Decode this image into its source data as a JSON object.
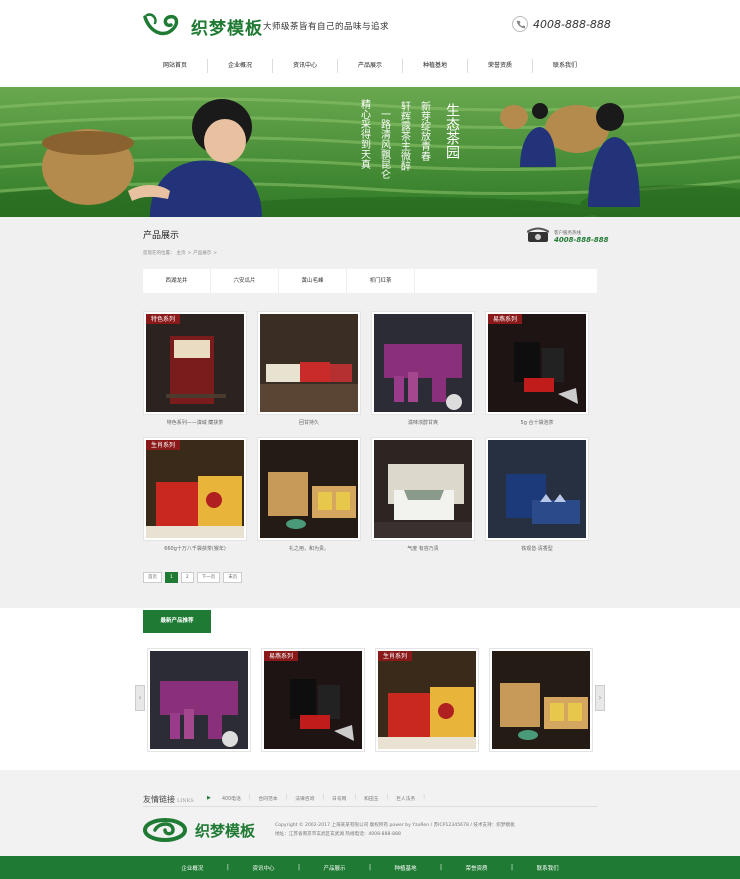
{
  "header": {
    "logo_text": "织梦模板",
    "slogan": "大师级茶皆有自己的品味与追求",
    "phone": "4008-888-888"
  },
  "nav": [
    "网站首页",
    "企业概况",
    "资讯中心",
    "产品展示",
    "种植基地",
    "荣誉资质",
    "联系我们"
  ],
  "banner": {
    "poem": [
      "生态茶园",
      "新芽绽放青春",
      "轩辉露茶主微醉",
      "一路清风飘昆仑",
      "精心采得到天真"
    ]
  },
  "page": {
    "title": "产品展示",
    "hotline_label": "客户服务热线",
    "hotline": "4008-888-888",
    "breadcrumb": [
      "您现在的位置：",
      "主页",
      ">",
      "产品展示",
      ">"
    ]
  },
  "categories": [
    "西湖龙井",
    "六安瓜片",
    "黄山毛峰",
    "祁门红茶"
  ],
  "products": [
    {
      "name": "特色系列——滇域 藏茯茶",
      "tag": "特色系列",
      "theme": "red"
    },
    {
      "name": "回甘持久",
      "tag": "",
      "theme": "dark"
    },
    {
      "name": "滋味浓醇甘爽",
      "tag": "",
      "theme": "purple"
    },
    {
      "name": "5g 合十袋泡茶",
      "tag": "易燕系列",
      "theme": "black"
    },
    {
      "name": "660g十万八千袋茯茶(猴年)",
      "tag": "生肖系列",
      "theme": "yellow"
    },
    {
      "name": "礼之用，和为贵。",
      "tag": "",
      "theme": "gold"
    },
    {
      "name": "气度 有容乃贵",
      "tag": "",
      "theme": "white"
    },
    {
      "name": "铁观音·清香型",
      "tag": "",
      "theme": "blue"
    }
  ],
  "pagination": [
    "首页",
    "1",
    "2",
    "下一页",
    "末页"
  ],
  "recommended": {
    "title": "最新产品推荐",
    "items": [
      {
        "theme": "purple",
        "tag": ""
      },
      {
        "theme": "black",
        "tag": "易燕系列"
      },
      {
        "theme": "yellow",
        "tag": "生肖系列"
      },
      {
        "theme": "gold",
        "tag": ""
      }
    ]
  },
  "footer": {
    "links_title": "友情链接",
    "links_en": "LINKS",
    "links": [
      "400电话",
      "合同范本",
      "法律咨询",
      "日号网",
      "和田玉",
      "巨人法务"
    ],
    "logo_text": "织梦模板",
    "copyright": "Copyright © 2002-2017 上海某某有限公司 版权所有 power by YzuRen / 苏ICP12345678 / 技术支持：织梦模板",
    "address": "地址：江苏省南京市玄武区玄武湖 热线电话：4008-888-888"
  },
  "bottom_nav": [
    "企业概况",
    "资讯中心",
    "产品展示",
    "种植基地",
    "荣誉资质",
    "联系我们"
  ],
  "colors": {
    "brand": "#1f7a33",
    "banner_green": "#3e8f2e"
  }
}
